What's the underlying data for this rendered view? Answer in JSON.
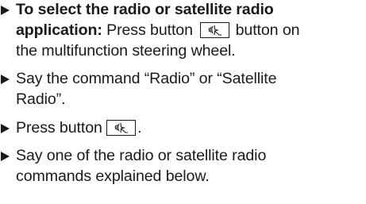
{
  "steps": [
    {
      "label": "To select the radio or satellite radio application:",
      "label_cont": "application:",
      "label_first": "To select the radio or satellite radio",
      "text_a": " Press button ",
      "text_b": " button on",
      "text_c": "the multifunction steering wheel."
    },
    {
      "text_a": "Say the command “Radio” or “Satellite",
      "text_b": "Radio”."
    },
    {
      "text_a": "Press button ",
      "text_b": "."
    },
    {
      "text_a": "Say one of the radio or satellite radio",
      "text_b": "commands explained below."
    }
  ],
  "icons": {
    "bullet": "right-triangle-arrow-icon",
    "voice_button": "voice-control-button-icon"
  },
  "colors": {
    "text": "#1a1a1a",
    "background": "#ffffff"
  }
}
